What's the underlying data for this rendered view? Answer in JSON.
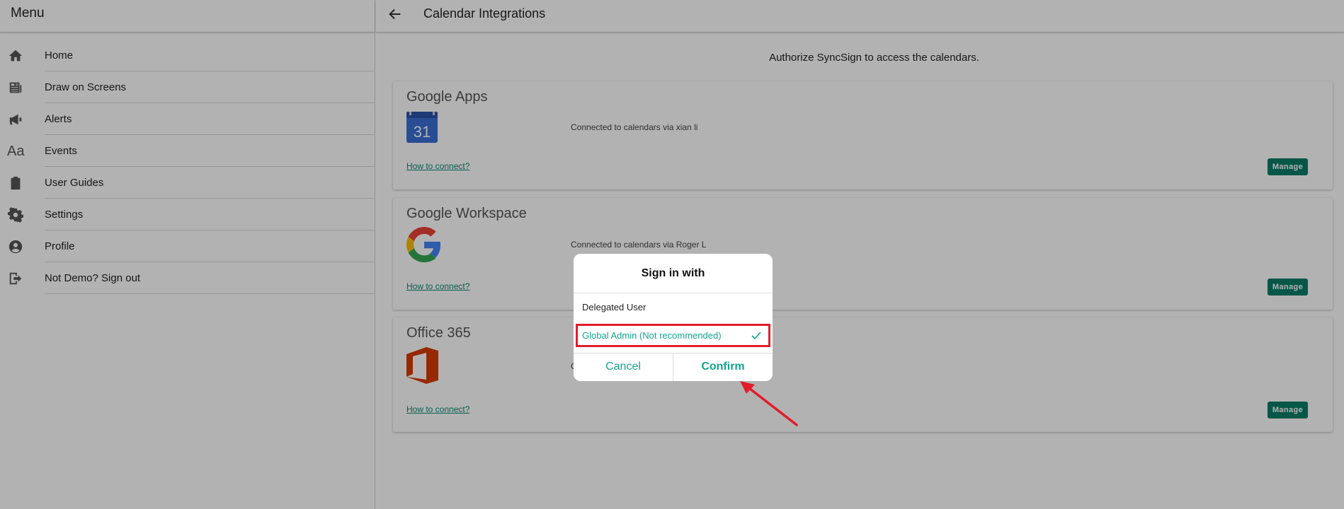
{
  "sidebar": {
    "title": "Menu",
    "items": [
      {
        "label": "Home",
        "icon": "home-icon"
      },
      {
        "label": "Draw on Screens",
        "icon": "newspaper-icon"
      },
      {
        "label": "Alerts",
        "icon": "megaphone-icon"
      },
      {
        "label": "Events",
        "icon": "font-icon",
        "glyph": "Aa"
      },
      {
        "label": "User Guides",
        "icon": "clipboard-icon"
      },
      {
        "label": "Settings",
        "icon": "gear-icon"
      },
      {
        "label": "Profile",
        "icon": "user-circle-icon"
      },
      {
        "label": "Not  Demo? Sign out",
        "icon": "sign-out-icon"
      }
    ]
  },
  "header": {
    "title": "Calendar Integrations"
  },
  "main": {
    "subtitle": "Authorize SyncSign to access the calendars.",
    "cards": [
      {
        "title": "Google Apps",
        "status": "Connected to calendars via xian li",
        "link": "How to connect?",
        "button": "Manage",
        "logo_text": "31"
      },
      {
        "title": "Google Workspace",
        "status": "Connected to calendars via Roger L",
        "link": "How to connect?",
        "button": "Manage"
      },
      {
        "title": "Office 365",
        "status": "C",
        "link": "How to connect?",
        "button": "Manage"
      }
    ]
  },
  "dialog": {
    "title": "Sign in with",
    "options": [
      {
        "label": "Delegated User",
        "selected": false
      },
      {
        "label": "Global Admin (Not recommended)",
        "selected": true
      }
    ],
    "cancel": "Cancel",
    "confirm": "Confirm"
  },
  "colors": {
    "accent": "#12a58c",
    "manage_button": "#0a7d66",
    "highlight": "#e21c2a"
  }
}
